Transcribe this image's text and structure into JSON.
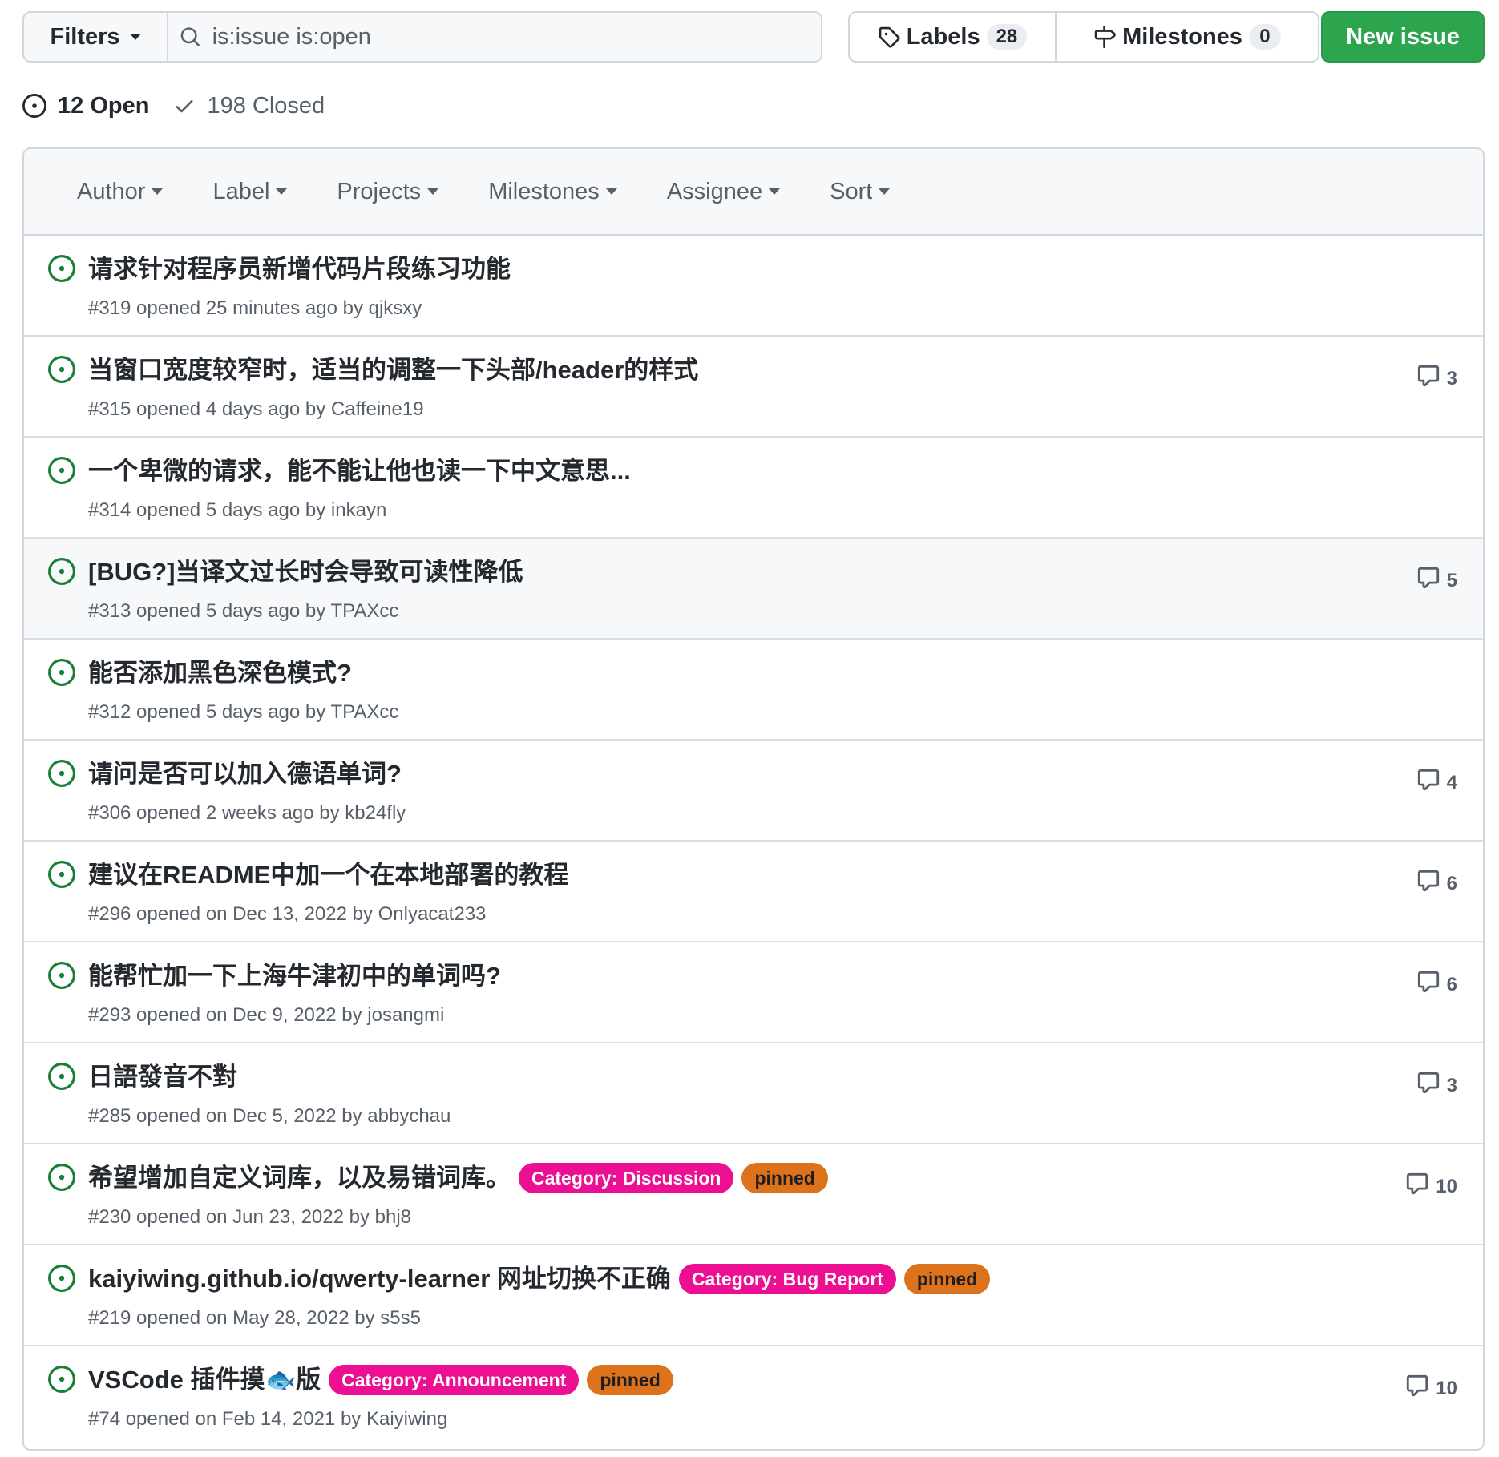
{
  "toolbar": {
    "filters_label": "Filters",
    "search_value": "is:issue is:open",
    "labels_label": "Labels",
    "labels_count": "28",
    "milestones_label": "Milestones",
    "milestones_count": "0",
    "new_issue_label": "New issue"
  },
  "states": {
    "open": "12 Open",
    "closed": "198 Closed"
  },
  "list_filters": [
    "Author",
    "Label",
    "Projects",
    "Milestones",
    "Assignee",
    "Sort"
  ],
  "issues": [
    {
      "title": "请求针对程序员新增代码片段练习功能",
      "meta": "#319 opened 25 minutes ago by qjksxy",
      "comments": "",
      "labels": [],
      "highlight": false
    },
    {
      "title": "当窗口宽度较窄时，适当的调整一下头部/header的样式",
      "meta": "#315 opened 4 days ago by Caffeine19",
      "comments": "3",
      "labels": [],
      "highlight": false
    },
    {
      "title": "一个卑微的请求，能不能让他也读一下中文意思...",
      "meta": "#314 opened 5 days ago by inkayn",
      "comments": "",
      "labels": [],
      "highlight": false
    },
    {
      "title": "[BUG?]当译文过长时会导致可读性降低",
      "meta": "#313 opened 5 days ago by TPAXcc",
      "comments": "5",
      "labels": [],
      "highlight": true
    },
    {
      "title": "能否添加黑色深色模式?",
      "meta": "#312 opened 5 days ago by TPAXcc",
      "comments": "",
      "labels": [],
      "highlight": false
    },
    {
      "title": "请问是否可以加入德语单词?",
      "meta": "#306 opened 2 weeks ago by kb24fly",
      "comments": "4",
      "labels": [],
      "highlight": false
    },
    {
      "title": "建议在README中加一个在本地部署的教程",
      "meta": "#296 opened on Dec 13, 2022 by Onlyacat233",
      "comments": "6",
      "labels": [],
      "highlight": false
    },
    {
      "title": "能帮忙加一下上海牛津初中的单词吗?",
      "meta": "#293 opened on Dec 9, 2022 by josangmi",
      "comments": "6",
      "labels": [],
      "highlight": false
    },
    {
      "title": "日語發音不對",
      "meta": "#285 opened on Dec 5, 2022 by abbychau",
      "comments": "3",
      "labels": [],
      "highlight": false
    },
    {
      "title": "希望增加自定义词库，以及易错词库。",
      "meta": "#230 opened on Jun 23, 2022 by bhj8",
      "comments": "10",
      "labels": [
        {
          "text": "Category: Discussion",
          "kind": "category"
        },
        {
          "text": "pinned",
          "kind": "pinned"
        }
      ],
      "highlight": false
    },
    {
      "title": "kaiyiwing.github.io/qwerty-learner 网址切换不正确",
      "meta": "#219 opened on May 28, 2022 by s5s5",
      "comments": "",
      "labels": [
        {
          "text": "Category: Bug Report",
          "kind": "category"
        },
        {
          "text": "pinned",
          "kind": "pinned"
        }
      ],
      "highlight": false
    },
    {
      "title": "VSCode 插件摸🐟版",
      "meta": "#74 opened on Feb 14, 2021 by Kaiyiwing",
      "comments": "10",
      "labels": [
        {
          "text": "Category: Announcement",
          "kind": "category"
        },
        {
          "text": "pinned",
          "kind": "pinned"
        }
      ],
      "highlight": false
    }
  ],
  "colors": {
    "open_icon": "#1a7f37",
    "new_issue_bg": "#2da44e",
    "category_label": "#ec0f91",
    "pinned_label": "#dc731c"
  }
}
